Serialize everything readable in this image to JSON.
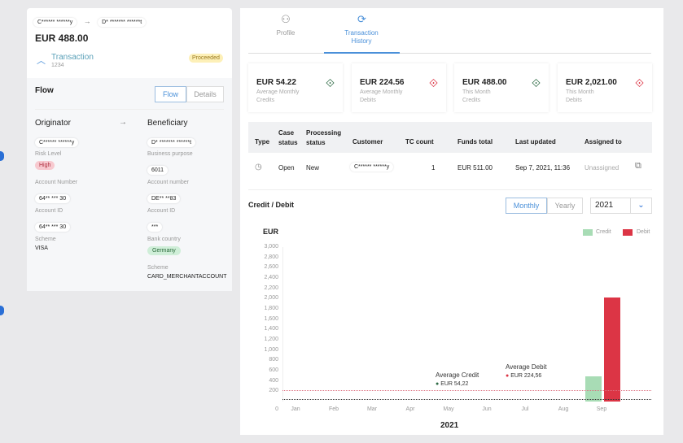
{
  "left": {
    "from": "C****** ******y",
    "to": "D* ******* ******t",
    "amount": "EUR 488.00",
    "transaction_label": "Transaction",
    "transaction_id": "1234",
    "status": "Proceeded",
    "flow_title": "Flow",
    "toggle": [
      "Flow",
      "Details"
    ],
    "originator": {
      "title": "Originator",
      "name": "C****** ******y",
      "risk_label": "Risk Level",
      "risk": "High",
      "acct_num_label": "Account Number",
      "acct_num": "64** *** 30",
      "acct_id_label": "Account ID",
      "acct_id": "64** *** 30",
      "scheme_label": "Scheme",
      "scheme": "VISA"
    },
    "beneficiary": {
      "title": "Beneficiary",
      "name": "D* ******* ******t",
      "purpose_label": "Business purpose",
      "purpose": "6011",
      "acct_num_label": "Account number",
      "acct_num": "DE** **83",
      "acct_id_label": "Account ID",
      "acct_id": "***",
      "country_label": "Bank country",
      "country": "Germany",
      "scheme_label": "Scheme",
      "scheme": "CARD_MERCHANTACCOUNT"
    }
  },
  "tabs": [
    {
      "label": "Profile",
      "icon": "user-icon"
    },
    {
      "label": "Transaction History",
      "icon": "transaction-history-icon",
      "active": true
    }
  ],
  "stats": [
    {
      "amount": "EUR 54.22",
      "line1": "Average Monthly",
      "line2": "Credits",
      "type": "credit"
    },
    {
      "amount": "EUR 224.56",
      "line1": "Average Monthly",
      "line2": "Debits",
      "type": "debit"
    },
    {
      "amount": "EUR 488.00",
      "line1": "This Month",
      "line2": "Credits",
      "type": "credit"
    },
    {
      "amount": "EUR 2,021.00",
      "line1": "This Month",
      "line2": "Debits",
      "type": "debit"
    }
  ],
  "table": {
    "headers": [
      "Type",
      "Case status",
      "Processing status",
      "Customer",
      "TC count",
      "Funds total",
      "Last updated",
      "Assigned to"
    ],
    "rows": [
      {
        "case_status": "Open",
        "processing_status": "New",
        "customer": "C****** ******y",
        "tc_count": "1",
        "funds_total": "EUR 511.00",
        "last_updated": "Sep 7, 2021, 11:36",
        "assigned_to": "Unassigned"
      }
    ]
  },
  "chart_section": {
    "title": "Credit / Debit",
    "period": [
      "Monthly",
      "Yearly"
    ],
    "year": "2021"
  },
  "colors": {
    "credit": "#a8dcb5",
    "debit": "#dc3545",
    "accent": "#4a90d9"
  },
  "chart_data": {
    "type": "bar",
    "ylabel": "EUR",
    "xlabel": "2021",
    "ylim": [
      0,
      3000
    ],
    "yticks": [
      "0",
      "200",
      "400",
      "600",
      "800",
      "1,000",
      "1,200",
      "1,400",
      "1,600",
      "1,800",
      "2,000",
      "2,200",
      "2,400",
      "2,600",
      "2,800",
      "3,000"
    ],
    "categories": [
      "Jan",
      "Feb",
      "Mar",
      "Apr",
      "May",
      "Jun",
      "Jul",
      "Aug",
      "Sep"
    ],
    "series": [
      {
        "name": "Credit",
        "values": [
          0,
          0,
          0,
          0,
          0,
          0,
          0,
          0,
          488
        ]
      },
      {
        "name": "Debit",
        "values": [
          0,
          0,
          0,
          0,
          0,
          0,
          0,
          0,
          2021
        ]
      }
    ],
    "legend": "top-right",
    "annotations": [
      {
        "title": "Average Credit",
        "label": "EUR 54,22",
        "value": 54.22
      },
      {
        "title": "Average Debit",
        "label": "EUR 224,56",
        "value": 224.56
      }
    ]
  }
}
